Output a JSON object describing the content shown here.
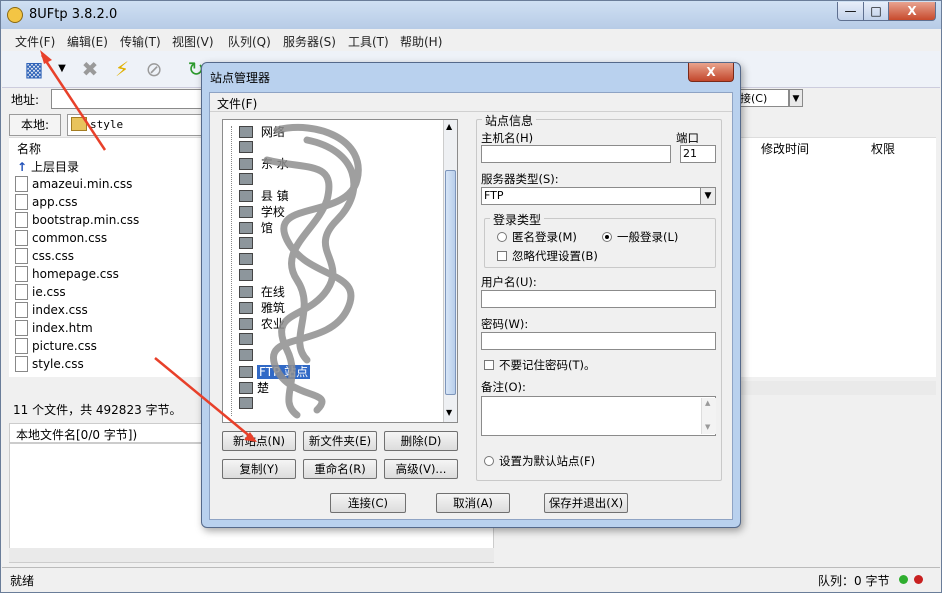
{
  "window": {
    "title": "8UFtp 3.8.2.0",
    "min": "—",
    "max": "□",
    "close": "X"
  },
  "menu": [
    {
      "label": "文件(F)",
      "name": "menu-file"
    },
    {
      "label": "编辑(E)",
      "name": "menu-edit"
    },
    {
      "label": "传输(T)",
      "name": "menu-transfer"
    },
    {
      "label": "视图(V)",
      "name": "menu-view"
    },
    {
      "label": "队列(Q)",
      "name": "menu-queue"
    },
    {
      "label": "服务器(S)",
      "name": "menu-server"
    },
    {
      "label": "工具(T)",
      "name": "menu-tools"
    },
    {
      "label": "帮助(H)",
      "name": "menu-help"
    }
  ],
  "toolbar": {
    "address_label": "地址:",
    "remote_connect": "接(C)"
  },
  "local": {
    "button": "本地:",
    "path": "style",
    "column_name": "名称",
    "files": [
      {
        "name": "上层目录",
        "type": "up"
      },
      {
        "name": "amazeui.min.css",
        "type": "file"
      },
      {
        "name": "app.css",
        "type": "file"
      },
      {
        "name": "bootstrap.min.css",
        "type": "file"
      },
      {
        "name": "common.css",
        "type": "file"
      },
      {
        "name": "css.css",
        "type": "file"
      },
      {
        "name": "homepage.css",
        "type": "file"
      },
      {
        "name": "ie.css",
        "type": "file"
      },
      {
        "name": "index.css",
        "type": "file"
      },
      {
        "name": "index.htm",
        "type": "file"
      },
      {
        "name": "picture.css",
        "type": "file"
      },
      {
        "name": "style.css",
        "type": "file"
      }
    ],
    "summary": "11 个文件，共 492823 字节。",
    "queue_header": "本地文件名[0/0 字节])"
  },
  "remote": {
    "col_modified": "修改时间",
    "col_perm": "权限"
  },
  "status": {
    "left": "就绪",
    "queue": "队列：0 字节"
  },
  "dialog": {
    "title": "站点管理器",
    "close": "X",
    "menu_file": "文件(F)",
    "tree": [
      {
        "label": "    网络"
      },
      {
        "label": ""
      },
      {
        "label": "  东  水"
      },
      {
        "label": "    "
      },
      {
        "label": "  县   镇"
      },
      {
        "label": "     学校"
      },
      {
        "label": "      馆"
      },
      {
        "label": ""
      },
      {
        "label": "       "
      },
      {
        "label": ""
      },
      {
        "label": "       在线"
      },
      {
        "label": "     雅筑"
      },
      {
        "label": "      农业"
      },
      {
        "label": ""
      },
      {
        "label": "   "
      },
      {
        "label": "FTP 站点",
        "selected": true
      },
      {
        "label": "楚"
      },
      {
        "label": "  "
      }
    ],
    "buttons": {
      "new_site": "新站点(N)",
      "new_folder": "新文件夹(E)",
      "delete": "删除(D)",
      "copy": "复制(Y)",
      "rename": "重命名(R)",
      "advanced": "高级(V)...",
      "connect": "连接(C)",
      "cancel": "取消(A)",
      "save_exit": "保存并退出(X)"
    },
    "site_info": {
      "legend": "站点信息",
      "host_label": "主机名(H)",
      "host_value": "",
      "port_label": "端口",
      "port_value": "21",
      "server_type_label": "服务器类型(S):",
      "server_type_value": "FTP",
      "login_legend": "登录类型",
      "anon_login": "匿名登录(M)",
      "normal_login": "一般登录(L)",
      "ignore_proxy": "忽略代理设置(B)",
      "username_label": "用户名(U):",
      "username_value": "",
      "password_label": "密码(W):",
      "password_value": "",
      "no_remember_pwd": "不要记住密码(T)。",
      "note_label": "备注(O):",
      "note_value": "",
      "default_site": "设置为默认站点(F)"
    }
  }
}
